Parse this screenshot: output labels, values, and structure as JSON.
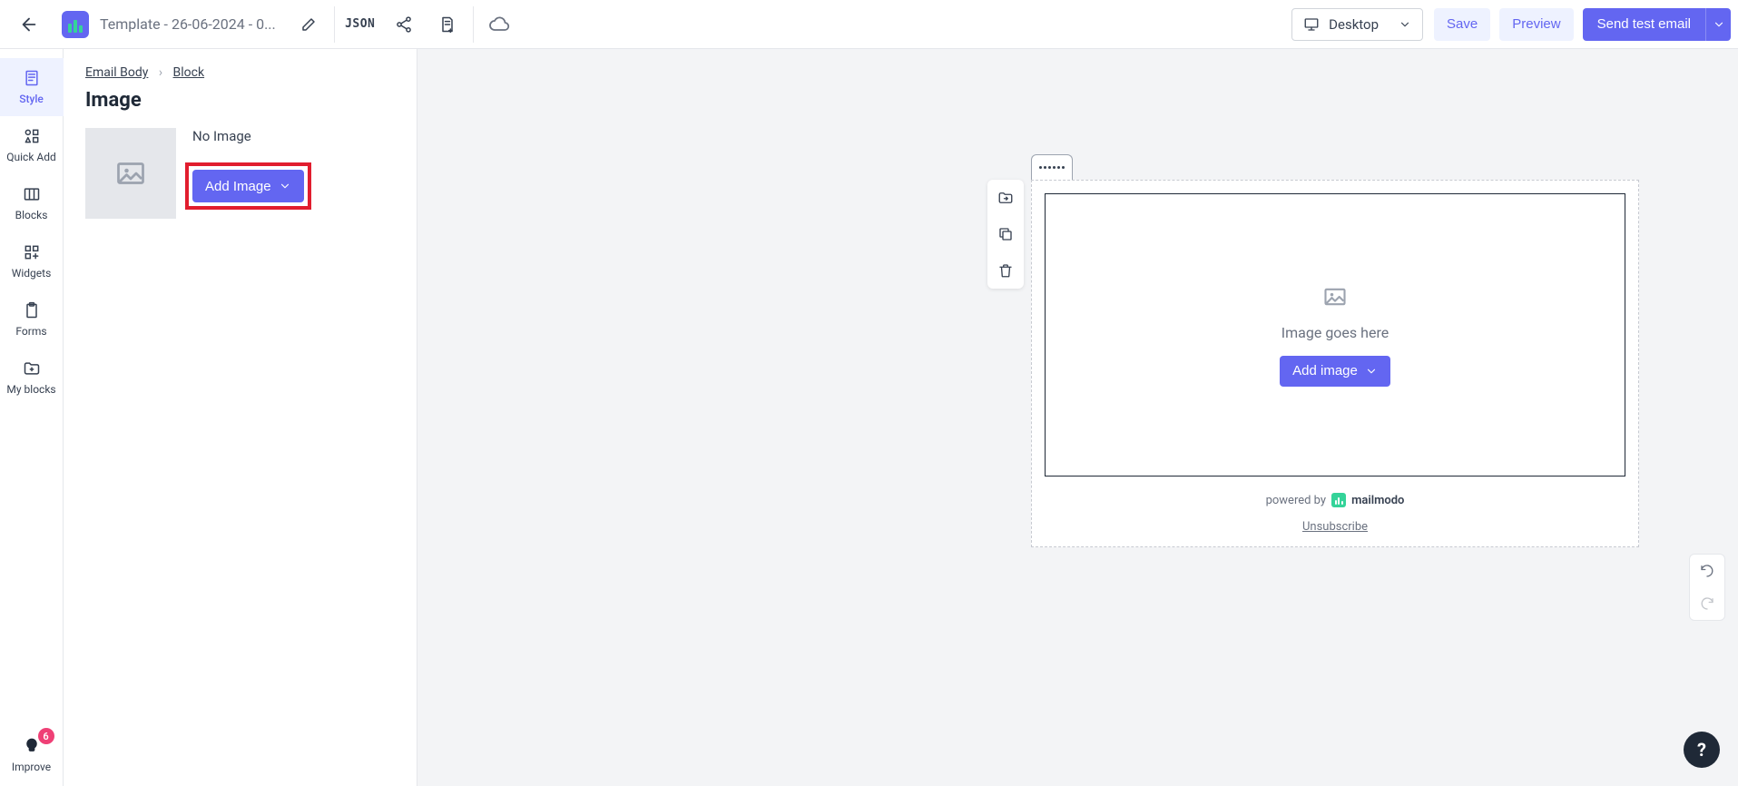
{
  "header": {
    "template_name": "Template - 26-06-2024 - 0...",
    "json_label": "JSON",
    "viewport_label": "Desktop",
    "save_label": "Save",
    "preview_label": "Preview",
    "send_label": "Send test email"
  },
  "nav": {
    "items": [
      {
        "label": "Style"
      },
      {
        "label": "Quick Add"
      },
      {
        "label": "Blocks"
      },
      {
        "label": "Widgets"
      },
      {
        "label": "Forms"
      },
      {
        "label": "My blocks"
      }
    ],
    "improve_label": "Improve",
    "improve_badge": "6"
  },
  "panel": {
    "crumb1": "Email Body",
    "crumb2": "Block",
    "title": "Image",
    "no_image": "No Image",
    "add_image_label": "Add Image"
  },
  "canvas": {
    "placeholder_text": "Image goes here",
    "add_image_label": "Add image",
    "powered_by": "powered by",
    "brand": "mailmodo",
    "unsubscribe": "Unsubscribe"
  },
  "help": "?"
}
